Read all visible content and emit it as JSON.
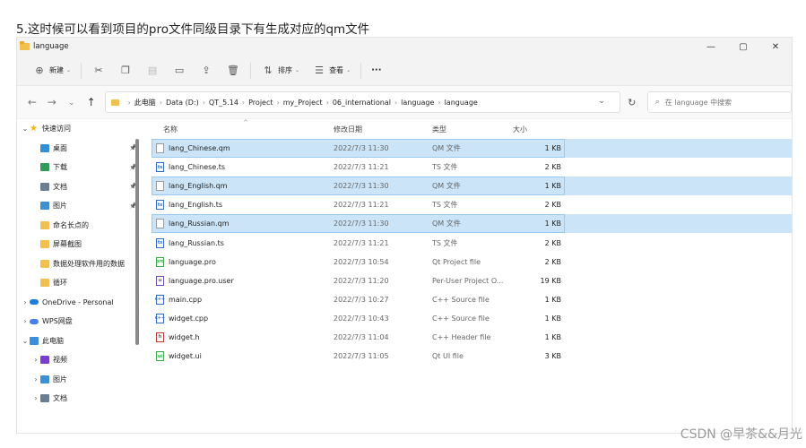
{
  "caption": "5.这时候可以看到项目的pro文件同级目录下有生成对应的qm文件",
  "window": {
    "title": "language",
    "controls": [
      "—",
      "▢",
      "✕"
    ]
  },
  "toolbar": {
    "new_label": "新建",
    "sort_label": "排序",
    "view_label": "查看",
    "more_label": "···"
  },
  "address": {
    "crumbs": [
      "此电脑",
      "Data (D:)",
      "QT_5.14",
      "Project",
      "my_Project",
      "06_international",
      "language",
      "language"
    ],
    "search_placeholder": "在 language 中搜索"
  },
  "sidebar": {
    "items": [
      {
        "label": "快速访问",
        "icon": "star-icon",
        "color": "#f5b400",
        "expander": "open",
        "pinned": false,
        "indent": 0
      },
      {
        "label": "桌面",
        "icon": "desktop-icon",
        "color": "#2f8fd8",
        "expander": "none",
        "pinned": true,
        "indent": 1
      },
      {
        "label": "下载",
        "icon": "download-icon",
        "color": "#2f9c5a",
        "expander": "none",
        "pinned": true,
        "indent": 1
      },
      {
        "label": "文档",
        "icon": "document-icon",
        "color": "#6b7d93",
        "expander": "none",
        "pinned": true,
        "indent": 1
      },
      {
        "label": "图片",
        "icon": "picture-icon",
        "color": "#3d8fd6",
        "expander": "none",
        "pinned": true,
        "indent": 1
      },
      {
        "label": "命名长点的",
        "icon": "folder-icon",
        "color": "#f2c04e",
        "expander": "none",
        "pinned": false,
        "indent": 1
      },
      {
        "label": "屏幕截图",
        "icon": "folder-icon",
        "color": "#f2c04e",
        "expander": "none",
        "pinned": false,
        "indent": 1
      },
      {
        "label": "数据处理软件用的数据",
        "icon": "folder-icon",
        "color": "#f2c04e",
        "expander": "none",
        "pinned": false,
        "indent": 1
      },
      {
        "label": "循环",
        "icon": "folder-icon",
        "color": "#f2c04e",
        "expander": "none",
        "pinned": false,
        "indent": 1
      },
      {
        "label": "OneDrive - Personal",
        "icon": "cloud-icon",
        "color": "#1f7fd8",
        "expander": "closed",
        "pinned": false,
        "indent": 0
      },
      {
        "label": "WPS网盘",
        "icon": "cloud-icon",
        "color": "#4a7fe8",
        "expander": "closed",
        "pinned": false,
        "indent": 0
      },
      {
        "label": "此电脑",
        "icon": "computer-icon",
        "color": "#3b8fd9",
        "expander": "open",
        "pinned": false,
        "indent": 0
      },
      {
        "label": "视频",
        "icon": "video-icon",
        "color": "#7a3fd0",
        "expander": "closed",
        "pinned": false,
        "indent": 1
      },
      {
        "label": "图片",
        "icon": "picture-icon",
        "color": "#3d8fd6",
        "expander": "closed",
        "pinned": false,
        "indent": 1
      },
      {
        "label": "文档",
        "icon": "document-icon",
        "color": "#6b7d93",
        "expander": "closed",
        "pinned": false,
        "indent": 1
      }
    ]
  },
  "columns": {
    "name": "名称",
    "date": "修改日期",
    "type": "类型",
    "size": "大小"
  },
  "files": [
    {
      "name": "lang_Chinese.qm",
      "date": "2022/7/3 11:30",
      "type": "QM 文件",
      "size": "1 KB",
      "icon": "blank-file-icon",
      "badge": "",
      "color": "#9a9a9a",
      "selected": true
    },
    {
      "name": "lang_Chinese.ts",
      "date": "2022/7/3 11:21",
      "type": "TS 文件",
      "size": "2 KB",
      "icon": "ts-file-icon",
      "badge": "ts",
      "color": "#2f6fc7",
      "selected": false
    },
    {
      "name": "lang_English.qm",
      "date": "2022/7/3 11:30",
      "type": "QM 文件",
      "size": "1 KB",
      "icon": "blank-file-icon",
      "badge": "",
      "color": "#9a9a9a",
      "selected": true
    },
    {
      "name": "lang_English.ts",
      "date": "2022/7/3 11:21",
      "type": "TS 文件",
      "size": "2 KB",
      "icon": "ts-file-icon",
      "badge": "ts",
      "color": "#2f6fc7",
      "selected": false
    },
    {
      "name": "lang_Russian.qm",
      "date": "2022/7/3 11:30",
      "type": "QM 文件",
      "size": "1 KB",
      "icon": "blank-file-icon",
      "badge": "",
      "color": "#9a9a9a",
      "selected": true
    },
    {
      "name": "lang_Russian.ts",
      "date": "2022/7/3 11:21",
      "type": "TS 文件",
      "size": "2 KB",
      "icon": "ts-file-icon",
      "badge": "ts",
      "color": "#2f6fc7",
      "selected": false
    },
    {
      "name": "language.pro",
      "date": "2022/7/3 10:54",
      "type": "Qt Project file",
      "size": "2 KB",
      "icon": "qt-project-icon",
      "badge": "pro",
      "color": "#41a84a",
      "selected": false
    },
    {
      "name": "language.pro.user",
      "date": "2022/7/3 11:20",
      "type": "Per-User Project O...",
      "size": "19 KB",
      "icon": "user-file-icon",
      "badge": "u",
      "color": "#6a4fb8",
      "selected": false
    },
    {
      "name": "main.cpp",
      "date": "2022/7/3 10:27",
      "type": "C++ Source file",
      "size": "1 KB",
      "icon": "cpp-file-icon",
      "badge": "c++",
      "color": "#2f6fc7",
      "selected": false
    },
    {
      "name": "widget.cpp",
      "date": "2022/7/3 10:43",
      "type": "C++ Source file",
      "size": "1 KB",
      "icon": "cpp-file-icon",
      "badge": "c++",
      "color": "#2f6fc7",
      "selected": false
    },
    {
      "name": "widget.h",
      "date": "2022/7/3 11:04",
      "type": "C++ Header file",
      "size": "1 KB",
      "icon": "header-file-icon",
      "badge": "h",
      "color": "#c0392b",
      "selected": false
    },
    {
      "name": "widget.ui",
      "date": "2022/7/3 11:05",
      "type": "Qt UI file",
      "size": "3 KB",
      "icon": "ui-file-icon",
      "badge": "ui",
      "color": "#41a84a",
      "selected": false
    }
  ],
  "watermark": "CSDN @早茶&&月光"
}
